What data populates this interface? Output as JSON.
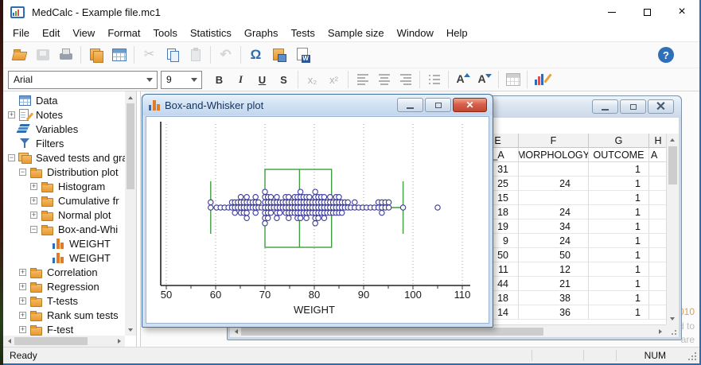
{
  "window": {
    "title": "MedCalc - Example file.mc1"
  },
  "menu": {
    "items": [
      "File",
      "Edit",
      "View",
      "Format",
      "Tools",
      "Statistics",
      "Graphs",
      "Tests",
      "Sample size",
      "Window",
      "Help"
    ]
  },
  "toolbar": {
    "help_label": "?",
    "buttons": [
      {
        "name": "open-file",
        "icon": "folder-open",
        "enabled": true
      },
      {
        "name": "save-file",
        "icon": "floppy",
        "enabled": false
      },
      {
        "name": "print",
        "icon": "printer",
        "enabled": true
      },
      {
        "sep": true
      },
      {
        "name": "duplicate-document",
        "icon": "copy-orange",
        "enabled": true
      },
      {
        "name": "data-table",
        "icon": "grid",
        "enabled": true
      },
      {
        "sep": true
      },
      {
        "name": "cut",
        "icon": "scissors",
        "enabled": false
      },
      {
        "name": "copy",
        "icon": "pages",
        "enabled": true
      },
      {
        "name": "paste",
        "icon": "clipboard",
        "enabled": false
      },
      {
        "sep": true
      },
      {
        "name": "undo",
        "icon": "undo-arrow",
        "enabled": false
      },
      {
        "sep": true
      },
      {
        "name": "recalculate",
        "icon": "omega-refresh",
        "enabled": true
      },
      {
        "name": "save-graph",
        "icon": "copy-save",
        "enabled": true
      },
      {
        "name": "export-to-word",
        "icon": "word-export",
        "enabled": true
      }
    ]
  },
  "format_bar": {
    "font_name": "Arial",
    "font_size": "9",
    "buttons": [
      {
        "name": "bold",
        "label": "B",
        "enabled": true
      },
      {
        "name": "italic",
        "label": "I",
        "enabled": true
      },
      {
        "name": "underline",
        "label": "U",
        "enabled": true
      },
      {
        "name": "strikethrough",
        "label": "S",
        "enabled": true
      },
      {
        "sep": true
      },
      {
        "name": "subscript",
        "label": "x₂",
        "enabled": false
      },
      {
        "name": "superscript",
        "label": "x²",
        "enabled": false
      },
      {
        "sep": true
      },
      {
        "name": "align-left",
        "icon": "align-left",
        "enabled": false
      },
      {
        "name": "align-center",
        "icon": "align-center",
        "enabled": false
      },
      {
        "name": "align-right",
        "icon": "align-right",
        "enabled": false
      },
      {
        "sep": true
      },
      {
        "name": "bullet-list",
        "icon": "list",
        "enabled": false
      },
      {
        "sep": true
      },
      {
        "name": "increase-font",
        "icon": "font-up",
        "enabled": true
      },
      {
        "name": "decrease-font",
        "icon": "font-down",
        "enabled": true
      },
      {
        "sep": true
      },
      {
        "name": "table-properties",
        "icon": "grid-gray",
        "enabled": false
      },
      {
        "sep": true
      },
      {
        "name": "edit-graph",
        "icon": "chart-edit",
        "enabled": true
      }
    ]
  },
  "sidebar": {
    "items": [
      {
        "label": "Data",
        "icon": "table",
        "depth": 0,
        "expand": ""
      },
      {
        "label": "Notes",
        "icon": "notes",
        "depth": 0,
        "expand": "+"
      },
      {
        "label": "Variables",
        "icon": "layers",
        "depth": 0,
        "expand": ""
      },
      {
        "label": "Filters",
        "icon": "funnel",
        "depth": 0,
        "expand": ""
      },
      {
        "label": "Saved tests and grap",
        "icon": "folders",
        "depth": 0,
        "expand": "-"
      },
      {
        "label": "Distribution plot",
        "icon": "folder",
        "depth": 1,
        "expand": "-"
      },
      {
        "label": "Histogram",
        "icon": "folder",
        "depth": 2,
        "expand": "+"
      },
      {
        "label": "Cumulative fr",
        "icon": "folder",
        "depth": 2,
        "expand": "+"
      },
      {
        "label": "Normal plot",
        "icon": "folder",
        "depth": 2,
        "expand": "+"
      },
      {
        "label": "Box-and-Whi",
        "icon": "folder",
        "depth": 2,
        "expand": "-"
      },
      {
        "label": "WEIGHT",
        "icon": "chart",
        "depth": 3,
        "expand": ""
      },
      {
        "label": "WEIGHT",
        "icon": "chart",
        "depth": 3,
        "expand": ""
      },
      {
        "label": "Correlation",
        "icon": "folder",
        "depth": 1,
        "expand": "+"
      },
      {
        "label": "Regression",
        "icon": "folder",
        "depth": 1,
        "expand": "+"
      },
      {
        "label": "T-tests",
        "icon": "folder",
        "depth": 1,
        "expand": "+"
      },
      {
        "label": "Rank sum tests",
        "icon": "folder",
        "depth": 1,
        "expand": "+"
      },
      {
        "label": "F-test",
        "icon": "folder",
        "depth": 1,
        "expand": "+"
      }
    ]
  },
  "plot_window": {
    "title": "Box-and-Whisker plot"
  },
  "chart_data": {
    "type": "box-dot",
    "title": "Box-and-Whisker plot",
    "xlabel": "WEIGHT",
    "xlim": [
      50,
      110
    ],
    "xticks": [
      50,
      60,
      70,
      80,
      90,
      100,
      110
    ],
    "grid": "vertical-dotted",
    "box": {
      "lower_whisker": 59,
      "q1": 70,
      "median": 77,
      "q3": 83.5,
      "upper_whisker": 98
    },
    "outliers": [
      105
    ],
    "box_color": "#3f9e3f",
    "dot_color": "#3a3a99",
    "dot_stacks": [
      [
        59,
        2
      ],
      [
        60.2,
        1
      ],
      [
        61,
        1
      ],
      [
        61.8,
        1
      ],
      [
        62.6,
        1
      ],
      [
        63.3,
        2
      ],
      [
        63.9,
        3
      ],
      [
        64.5,
        2
      ],
      [
        65.1,
        4
      ],
      [
        65.7,
        3
      ],
      [
        66.3,
        5
      ],
      [
        66.9,
        2
      ],
      [
        67.5,
        2
      ],
      [
        68.1,
        4
      ],
      [
        68.7,
        2
      ],
      [
        69.3,
        1
      ],
      [
        70,
        7
      ],
      [
        70.6,
        5
      ],
      [
        71.2,
        4
      ],
      [
        71.8,
        2
      ],
      [
        72.4,
        5
      ],
      [
        73,
        3
      ],
      [
        73.6,
        2
      ],
      [
        74.2,
        4
      ],
      [
        74.8,
        5
      ],
      [
        75.4,
        3
      ],
      [
        76,
        4
      ],
      [
        76.6,
        5
      ],
      [
        77.2,
        6
      ],
      [
        77.8,
        4
      ],
      [
        78.4,
        5
      ],
      [
        79,
        4
      ],
      [
        79.6,
        3
      ],
      [
        80.2,
        7
      ],
      [
        80.8,
        5
      ],
      [
        81.4,
        4
      ],
      [
        82,
        5
      ],
      [
        82.6,
        3
      ],
      [
        83.2,
        4
      ],
      [
        83.8,
        3
      ],
      [
        84.4,
        4
      ],
      [
        85,
        4
      ],
      [
        85.6,
        3
      ],
      [
        86.2,
        2
      ],
      [
        86.8,
        2
      ],
      [
        87.4,
        1
      ],
      [
        88.2,
        2
      ],
      [
        89,
        1
      ],
      [
        89.8,
        1
      ],
      [
        90.6,
        1
      ],
      [
        91.4,
        1
      ],
      [
        92.2,
        1
      ],
      [
        93,
        2
      ],
      [
        93.7,
        3
      ],
      [
        94.4,
        2
      ],
      [
        95.1,
        2
      ],
      [
        98,
        1
      ]
    ]
  },
  "sheet": {
    "col_letters": [
      "E",
      "F",
      "G",
      "H"
    ],
    "col_fields": [
      "DE_A",
      "MORPHOLOGY",
      "OUTCOME",
      "A"
    ],
    "rows": [
      [
        "31",
        "",
        "1"
      ],
      [
        "25",
        "24",
        "1"
      ],
      [
        "15",
        "",
        "1"
      ],
      [
        "18",
        "24",
        "1"
      ],
      [
        "19",
        "34",
        "1"
      ],
      [
        "9",
        "24",
        "1"
      ],
      [
        "50",
        "50",
        "1"
      ],
      [
        "11",
        "12",
        "1"
      ],
      [
        "44",
        "21",
        "1"
      ],
      [
        "18",
        "38",
        "1"
      ],
      [
        "14",
        "36",
        "1"
      ]
    ]
  },
  "watermark": {
    "lines": [
      {
        "text": "010",
        "color": "#dfa04a"
      },
      {
        "text": "d to",
        "color": "#bcbcbc"
      },
      {
        "text": "are",
        "color": "#bcbcbc"
      }
    ]
  },
  "status_bar": {
    "left": "Ready",
    "right": "NUM"
  }
}
